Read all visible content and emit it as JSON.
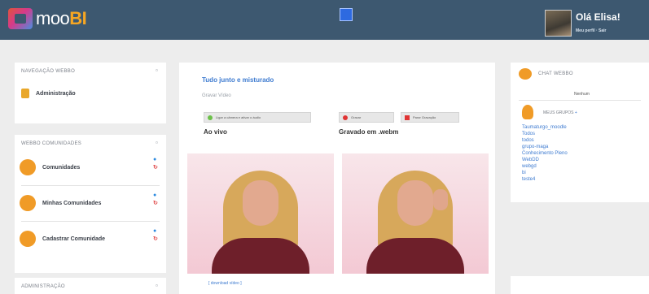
{
  "header": {
    "logo_prefix": "moo",
    "logo_suffix": "BI",
    "user_name": "Olá Elisa!",
    "user_links": "Meu perfil · Sair"
  },
  "nav_panel": {
    "title": "NAVEGAÇÃO WEBBO",
    "item": "Administração"
  },
  "communities_panel": {
    "title": "WEBBO COMUNIDADES",
    "items": [
      "Comunidades",
      "Minhas Comunidades",
      "Cadastrar Comunidade"
    ]
  },
  "admin_panel": {
    "title": "ADMINISTRAÇÃO"
  },
  "main": {
    "title": "Tudo junto e misturado",
    "subtitle": "Gravar Vídeo",
    "btn_toggle": "Ligar a câmera e ativar o áudio",
    "btn_record": "Gravar",
    "btn_stop": "Parar Gravação",
    "live_label": "Ao vivo",
    "recorded_label": "Gravado em .webm",
    "download": "[ download vídeo ]"
  },
  "chat": {
    "title": "CHAT WEBBO",
    "none": "Nenhum",
    "groups_label": "MEUS GRUPOS",
    "groups": [
      "Taumaturgo_moodle",
      "Todos",
      "todos",
      "grupo-maga",
      "Conhecimento Pleno",
      "WebDD",
      "webgd",
      "bi",
      "teste4"
    ]
  },
  "colors": {
    "header_bg": "#3d5870",
    "accent_orange": "#f09b27",
    "link_blue": "#3e7bd0"
  }
}
